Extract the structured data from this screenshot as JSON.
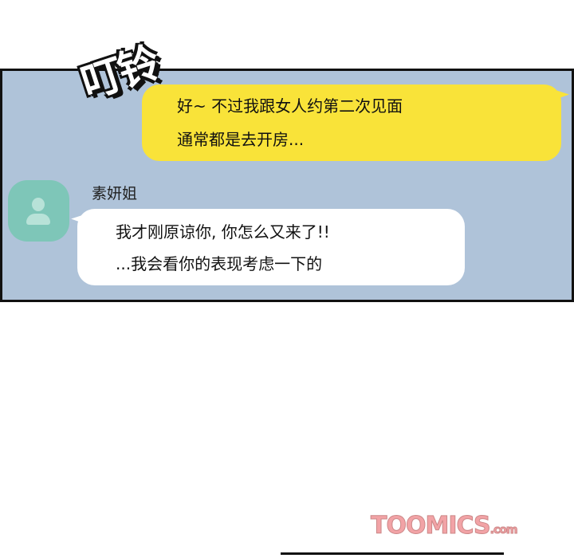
{
  "sound_effect": "叮铃",
  "messages": [
    {
      "sender": "self",
      "lines": [
        "好~ 不过我跟女人约第二次见面",
        "通常都是去开房..."
      ]
    },
    {
      "sender": "素妍姐",
      "lines": [
        "我才刚原谅你, 你怎么又来了!!",
        "...我会看你的表现考虑一下的"
      ]
    }
  ],
  "watermark": {
    "main": "TOOMICS",
    "suffix": ".com"
  },
  "colors": {
    "panel_bg": "#afc3d9",
    "self_bubble": "#f9e339",
    "other_bubble": "#ffffff",
    "avatar": "#7ec6b8"
  }
}
